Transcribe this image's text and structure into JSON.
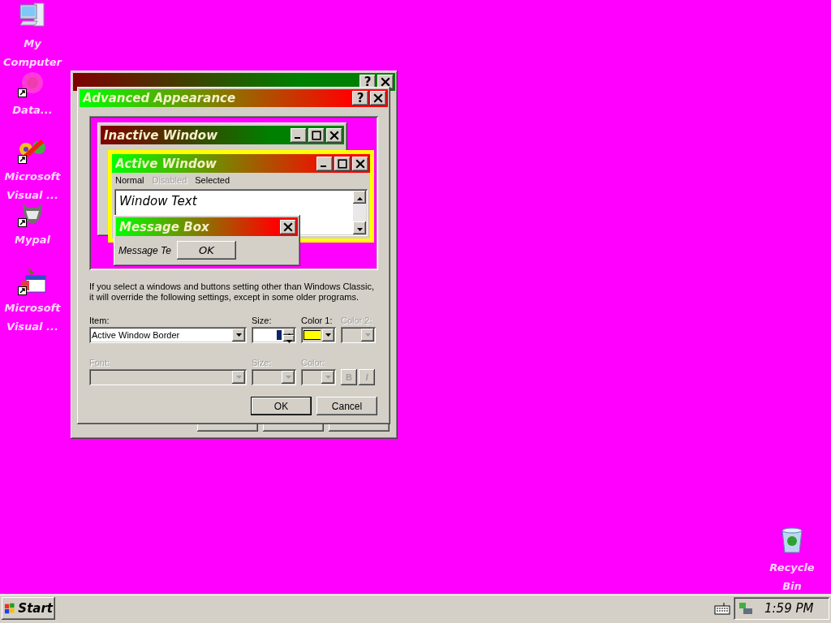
{
  "desktop_icons": [
    {
      "kind": "computer",
      "label": "My Computer",
      "shortcut": false
    },
    {
      "kind": "blur",
      "label": "Data...",
      "shortcut": true
    },
    {
      "kind": "studio",
      "label": "Microsoft Visual ...",
      "shortcut": true
    },
    {
      "kind": "animal",
      "label": "Mypal",
      "shortcut": true
    },
    {
      "kind": "calendar",
      "label": "Microsoft Visual ...",
      "shortcut": true
    },
    {
      "kind": "recycle",
      "label": "Recycle Bin",
      "shortcut": false
    }
  ],
  "display_properties": {
    "active": false,
    "caption_buttons": [
      {
        "kind": "help",
        "label": "?"
      },
      {
        "kind": "close"
      }
    ]
  },
  "advanced_appearance": {
    "title": "Advanced Appearance",
    "active": true,
    "caption_buttons": [
      {
        "kind": "help",
        "label": "?"
      },
      {
        "kind": "close"
      }
    ],
    "preview": {
      "inactive_window": {
        "title": "Inactive Window",
        "active": false,
        "caption_buttons": [
          {
            "kind": "minimize"
          },
          {
            "kind": "maximize"
          },
          {
            "kind": "close"
          }
        ]
      },
      "active_window": {
        "title": "Active Window",
        "active": true,
        "caption_buttons": [
          {
            "kind": "minimize"
          },
          {
            "kind": "maximize"
          },
          {
            "kind": "close"
          }
        ],
        "menu": [
          {
            "label": "Normal",
            "disabled": false
          },
          {
            "label": "Disabled",
            "disabled": true
          },
          {
            "label": "Selected",
            "disabled": false
          }
        ],
        "window_text": "Window Text"
      },
      "message_box": {
        "title": "Message Box",
        "active": true,
        "caption_buttons": [
          {
            "kind": "close"
          }
        ],
        "text": "Message Te",
        "button": "OK"
      }
    },
    "note": "If you select a windows and buttons setting other than Windows Classic, it will override the following settings, except in some older programs.",
    "item": {
      "label": "Item:",
      "value": "Active Window Border",
      "disabled": false
    },
    "size": {
      "label": "Size:",
      "disabled": false
    },
    "color_1": {
      "label": "Color 1:",
      "color": "#ffff00",
      "disabled": false
    },
    "color_2": {
      "label": "Color 2:",
      "disabled": true
    },
    "font": {
      "label": "Font:",
      "disabled": true
    },
    "font_size": {
      "label": "Size:",
      "disabled": true
    },
    "font_color": {
      "label": "Color:",
      "disabled": true
    },
    "bold": {
      "label": "B",
      "disabled": true
    },
    "italic": {
      "label": "I",
      "disabled": true
    },
    "buttons": [
      {
        "label": "OK",
        "default": true
      },
      {
        "label": "Cancel",
        "default": false
      }
    ]
  },
  "taskbar": {
    "start": "Start",
    "clock": "1:59 PM"
  }
}
